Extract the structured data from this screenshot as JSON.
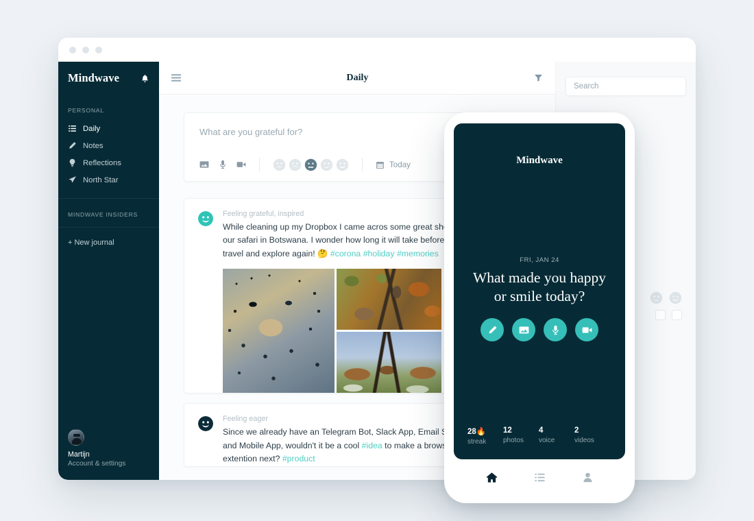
{
  "window": {
    "dots": [
      "close",
      "minimize",
      "maximize"
    ]
  },
  "sidebar": {
    "brand": "Mindwave",
    "bell_icon": "bell-icon",
    "section_personal": "PERSONAL",
    "items": [
      {
        "label": "Daily",
        "icon": "list-icon"
      },
      {
        "label": "Notes",
        "icon": "pen-icon"
      },
      {
        "label": "Reflections",
        "icon": "lightbulb-icon"
      },
      {
        "label": "North Star",
        "icon": "paper-plane-icon"
      }
    ],
    "section_insiders": "MINDWAVE INSIDERS",
    "new_journal": "+ New journal",
    "profile": {
      "name": "Martijn",
      "subtitle": "Account & settings",
      "avatar": "avatar"
    }
  },
  "topbar": {
    "menu_icon": "hamburger-icon",
    "title": "Daily",
    "filter_icon": "filter-icon"
  },
  "composer": {
    "placeholder": "What are you grateful for?",
    "tools": [
      {
        "name": "image-icon"
      },
      {
        "name": "microphone-icon"
      },
      {
        "name": "video-icon"
      }
    ],
    "moods": [
      {
        "name": "mood-very-sad",
        "selected": false
      },
      {
        "name": "mood-sad",
        "selected": false
      },
      {
        "name": "mood-neutral",
        "selected": true
      },
      {
        "name": "mood-happy",
        "selected": false
      },
      {
        "name": "mood-very-happy",
        "selected": false
      }
    ],
    "date_icon": "calendar-icon",
    "date_label": "Today"
  },
  "entries": [
    {
      "face": "smiley-teal",
      "feeling": "Feeling grateful, inspired",
      "text_1": "While cleaning up my Dropbox I came acros some great shots ",
      "text_2": "our safari in Botswana. I wonder how long it will take before w",
      "text_3": "travel and explore again! ",
      "emoji": "🤔",
      "tags": [
        "#corona",
        "#holiday",
        "#memories"
      ],
      "photos": [
        {
          "name": "photo-leopard"
        },
        {
          "name": "photo-kudu"
        },
        {
          "name": "photo-impalas"
        }
      ]
    },
    {
      "face": "smiley-dark",
      "feeling": "Feeling eager",
      "text_1": "Since we already have an Telegram Bot, Slack App, Email Serv",
      "text_2a": "and Mobile App, wouldn't it be a cool ",
      "tag_inline": "#idea",
      "text_2b": " to make a browse",
      "text_3": "extention next? ",
      "tag_end": "#product"
    }
  ],
  "rightpanel": {
    "search_placeholder": "Search",
    "search_value": "",
    "moods": [
      "mood-happy",
      "mood-very-happy"
    ],
    "checkboxes": [
      "checkbox-1",
      "checkbox-2"
    ]
  },
  "phone": {
    "brand": "Mindwave",
    "date": "FRI, JAN 24",
    "question_line1": "What made you happy",
    "question_line2": "or smile today?",
    "actions": [
      {
        "name": "pencil-icon"
      },
      {
        "name": "image-icon"
      },
      {
        "name": "microphone-icon"
      },
      {
        "name": "video-icon"
      }
    ],
    "stats": [
      {
        "value": "28🔥",
        "label": "streak"
      },
      {
        "value": "12",
        "label": "photos"
      },
      {
        "value": "4",
        "label": "voice"
      },
      {
        "value": "2",
        "label": "videos"
      }
    ],
    "nav": [
      {
        "name": "home-icon",
        "active": true
      },
      {
        "name": "list-icon",
        "active": false
      },
      {
        "name": "person-icon",
        "active": false
      }
    ]
  },
  "colors": {
    "brand_dark": "#072b36",
    "accent_teal": "#35bfb8",
    "page_bg": "#eef2f6",
    "tag": "#4ecdc4"
  }
}
